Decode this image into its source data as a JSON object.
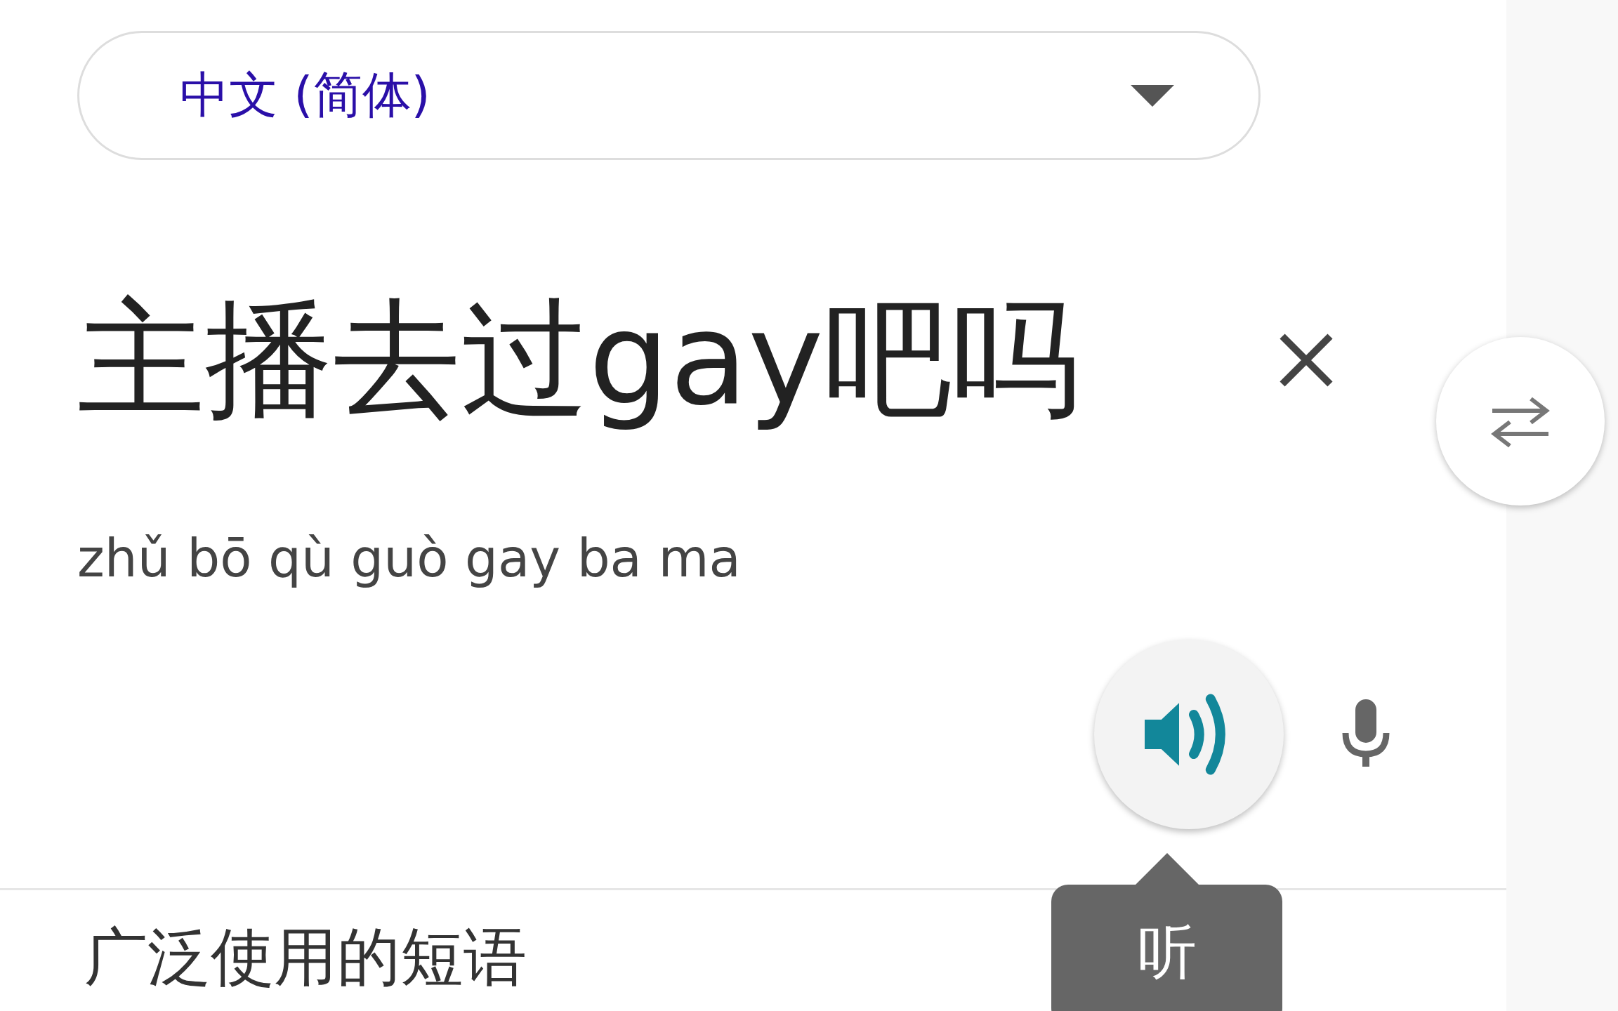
{
  "source_language": {
    "label": "中文 (简体)"
  },
  "input": {
    "text": "主播去过gay吧吗",
    "pinyin": "zhǔ bō qù guò gay ba ma"
  },
  "listen_tooltip": {
    "text": "听"
  },
  "section_heading": "广泛使用的短语"
}
